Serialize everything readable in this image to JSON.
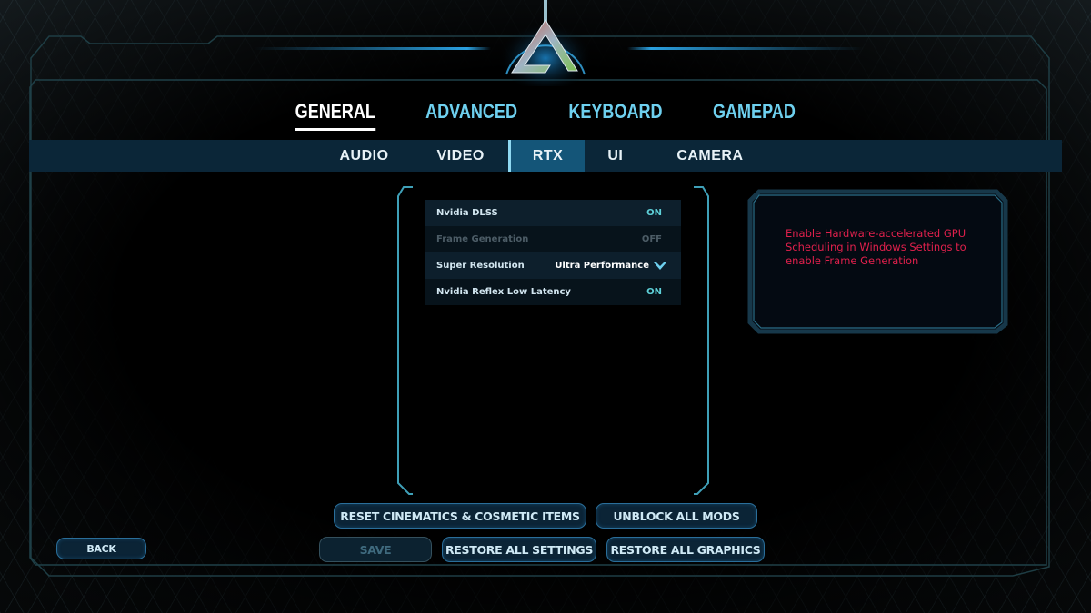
{
  "colors": {
    "accent_cyan": "#6ed0ef",
    "active_tab_bg": "#145578",
    "sub_bar_bg": "#0b2638",
    "value_on": "#5ed0d8",
    "warning_red": "#e0204c",
    "button_border": "#2a6e9a"
  },
  "logo": {
    "icon": "ark-logo-icon"
  },
  "top_tabs": [
    {
      "label": "GENERAL",
      "active": true
    },
    {
      "label": "ADVANCED",
      "active": false
    },
    {
      "label": "KEYBOARD",
      "active": false
    },
    {
      "label": "GAMEPAD",
      "active": false
    }
  ],
  "sub_tabs": [
    {
      "label": "AUDIO",
      "active": false
    },
    {
      "label": "VIDEO",
      "active": false
    },
    {
      "label": "RTX",
      "active": true
    },
    {
      "label": "UI",
      "active": false
    },
    {
      "label": "CAMERA",
      "active": false
    }
  ],
  "settings": [
    {
      "label": "Nvidia DLSS",
      "value": "ON",
      "enabled": true
    },
    {
      "label": "Frame Generation",
      "value": "OFF",
      "enabled": false
    },
    {
      "label": "Super Resolution",
      "value": "Ultra Performance",
      "type": "dropdown",
      "enabled": true
    },
    {
      "label": "Nvidia Reflex Low Latency",
      "value": "ON",
      "enabled": true
    }
  ],
  "info_panel": {
    "message": "Enable Hardware-accelerated GPU Scheduling in Windows Settings to enable Frame Generation"
  },
  "buttons": {
    "reset": "RESET CINEMATICS & COSMETIC ITEMS",
    "unblock": "UNBLOCK ALL MODS",
    "save": "SAVE",
    "restore_settings": "RESTORE ALL SETTINGS",
    "restore_graphics": "RESTORE ALL GRAPHICS",
    "back": "BACK"
  }
}
